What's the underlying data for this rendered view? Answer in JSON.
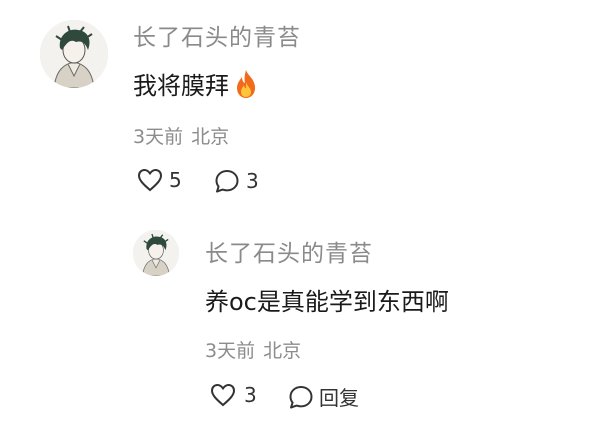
{
  "comment": {
    "username": "长了石头的青苔",
    "text": "我将膜拜",
    "emoji_icon": "fire-icon",
    "time": "3天前",
    "location": "北京",
    "likes": "5",
    "replies": "3"
  },
  "reply": {
    "username": "长了石头的青苔",
    "text": "养oc是真能学到东西啊",
    "time": "3天前",
    "location": "北京",
    "likes": "3",
    "reply_label": "回复"
  },
  "colors": {
    "username": "#8a8a8a",
    "text": "#1a1a1a",
    "meta": "#8c8c8c",
    "icon": "#333333"
  }
}
